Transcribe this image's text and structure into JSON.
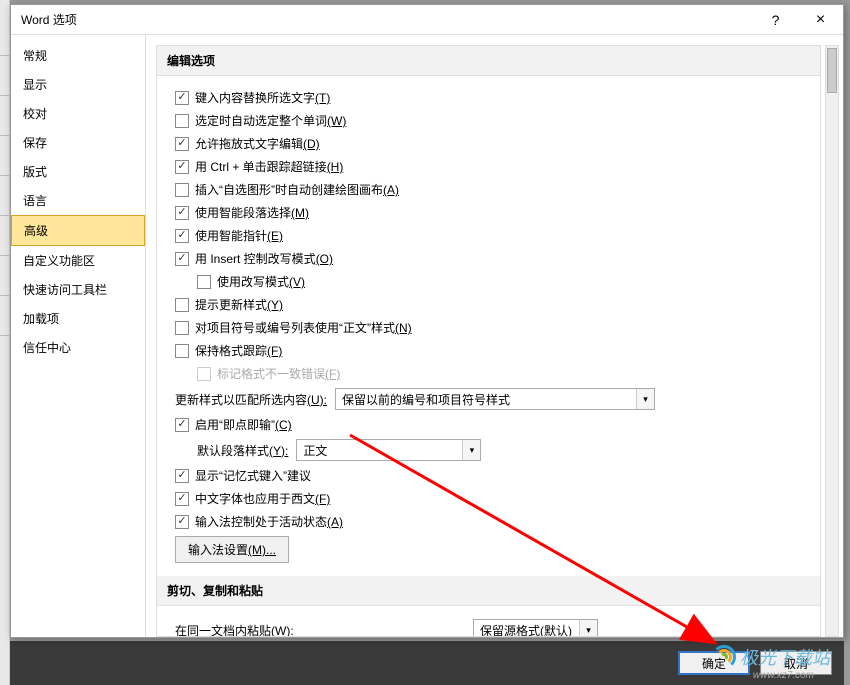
{
  "window": {
    "title": "Word 选项",
    "help_symbol": "?",
    "close_symbol": "×"
  },
  "sidebar": {
    "items": [
      {
        "label": "常规"
      },
      {
        "label": "显示"
      },
      {
        "label": "校对"
      },
      {
        "label": "保存"
      },
      {
        "label": "版式"
      },
      {
        "label": "语言"
      },
      {
        "label": "高级",
        "active": true
      },
      {
        "label": "自定义功能区"
      },
      {
        "label": "快速访问工具栏"
      },
      {
        "label": "加载项"
      },
      {
        "label": "信任中心"
      }
    ]
  },
  "sections": {
    "edit": {
      "header": "编辑选项",
      "opts": {
        "replace_selected": {
          "label": "键入内容替换所选文字",
          "accel": "(T)",
          "checked": true
        },
        "auto_select_word": {
          "label": "选定时自动选定整个单词",
          "accel": "(W)",
          "checked": false
        },
        "drag_drop": {
          "label": "允许拖放式文字编辑",
          "accel": "(D)",
          "checked": true
        },
        "ctrl_click": {
          "label": "用 Ctrl + 单击跟踪超链接",
          "accel": "(H)",
          "checked": true
        },
        "autoshape_canvas": {
          "label": "插入“自选图形”时自动创建绘图画布",
          "accel": "(A)",
          "checked": false
        },
        "smart_para": {
          "label": "使用智能段落选择",
          "accel": "(M)",
          "checked": true
        },
        "smart_cursor": {
          "label": "使用智能指针",
          "accel": "(E)",
          "checked": true
        },
        "insert_overtype": {
          "label": "用 Insert 控制改写模式",
          "accel": "(O)",
          "checked": true
        },
        "use_overtype": {
          "label": "使用改写模式",
          "accel": "(V)",
          "checked": false
        },
        "prompt_style": {
          "label": "提示更新样式",
          "accel": "(Y)",
          "checked": false
        },
        "normal_bullets": {
          "label": "对项目符号或编号列表使用“正文”样式",
          "accel": "(N)",
          "checked": false
        },
        "keep_track_fmt": {
          "label": "保持格式跟踪",
          "accel": "(F)",
          "checked": false
        },
        "mark_inconsist": {
          "label": "标记格式不一致错误",
          "accel": "(F)",
          "checked": false,
          "disabled": true
        }
      },
      "update_style": {
        "label": "更新样式以匹配所选内容",
        "accel": "(U):",
        "value": "保留以前的编号和项目符号样式"
      },
      "click_type": {
        "label": "启用“即点即输”",
        "accel": "(C)",
        "checked": true
      },
      "default_para": {
        "label": "默认段落样式",
        "accel": "(Y):",
        "value": "正文"
      },
      "autocomplete": {
        "label": "显示“记忆式键入”建议",
        "checked": true
      },
      "cjk_western": {
        "label": "中文字体也应用于西文",
        "accel": "(F)",
        "checked": true
      },
      "ime_active": {
        "label": "输入法控制处于活动状态",
        "accel": "(A)",
        "checked": true
      },
      "ime_button": {
        "label": "输入法设置",
        "accel": "(M)..."
      }
    },
    "paste": {
      "header": "剪切、复制和粘贴",
      "same_doc": {
        "label": "在同一文档内粘贴",
        "accel": "(W):",
        "value": "保留源格式(默认)"
      }
    }
  },
  "footer": {
    "ok": "确定",
    "cancel": "取消"
  },
  "watermark": {
    "text": "极光下载站",
    "sub": "www.xz7.com"
  }
}
